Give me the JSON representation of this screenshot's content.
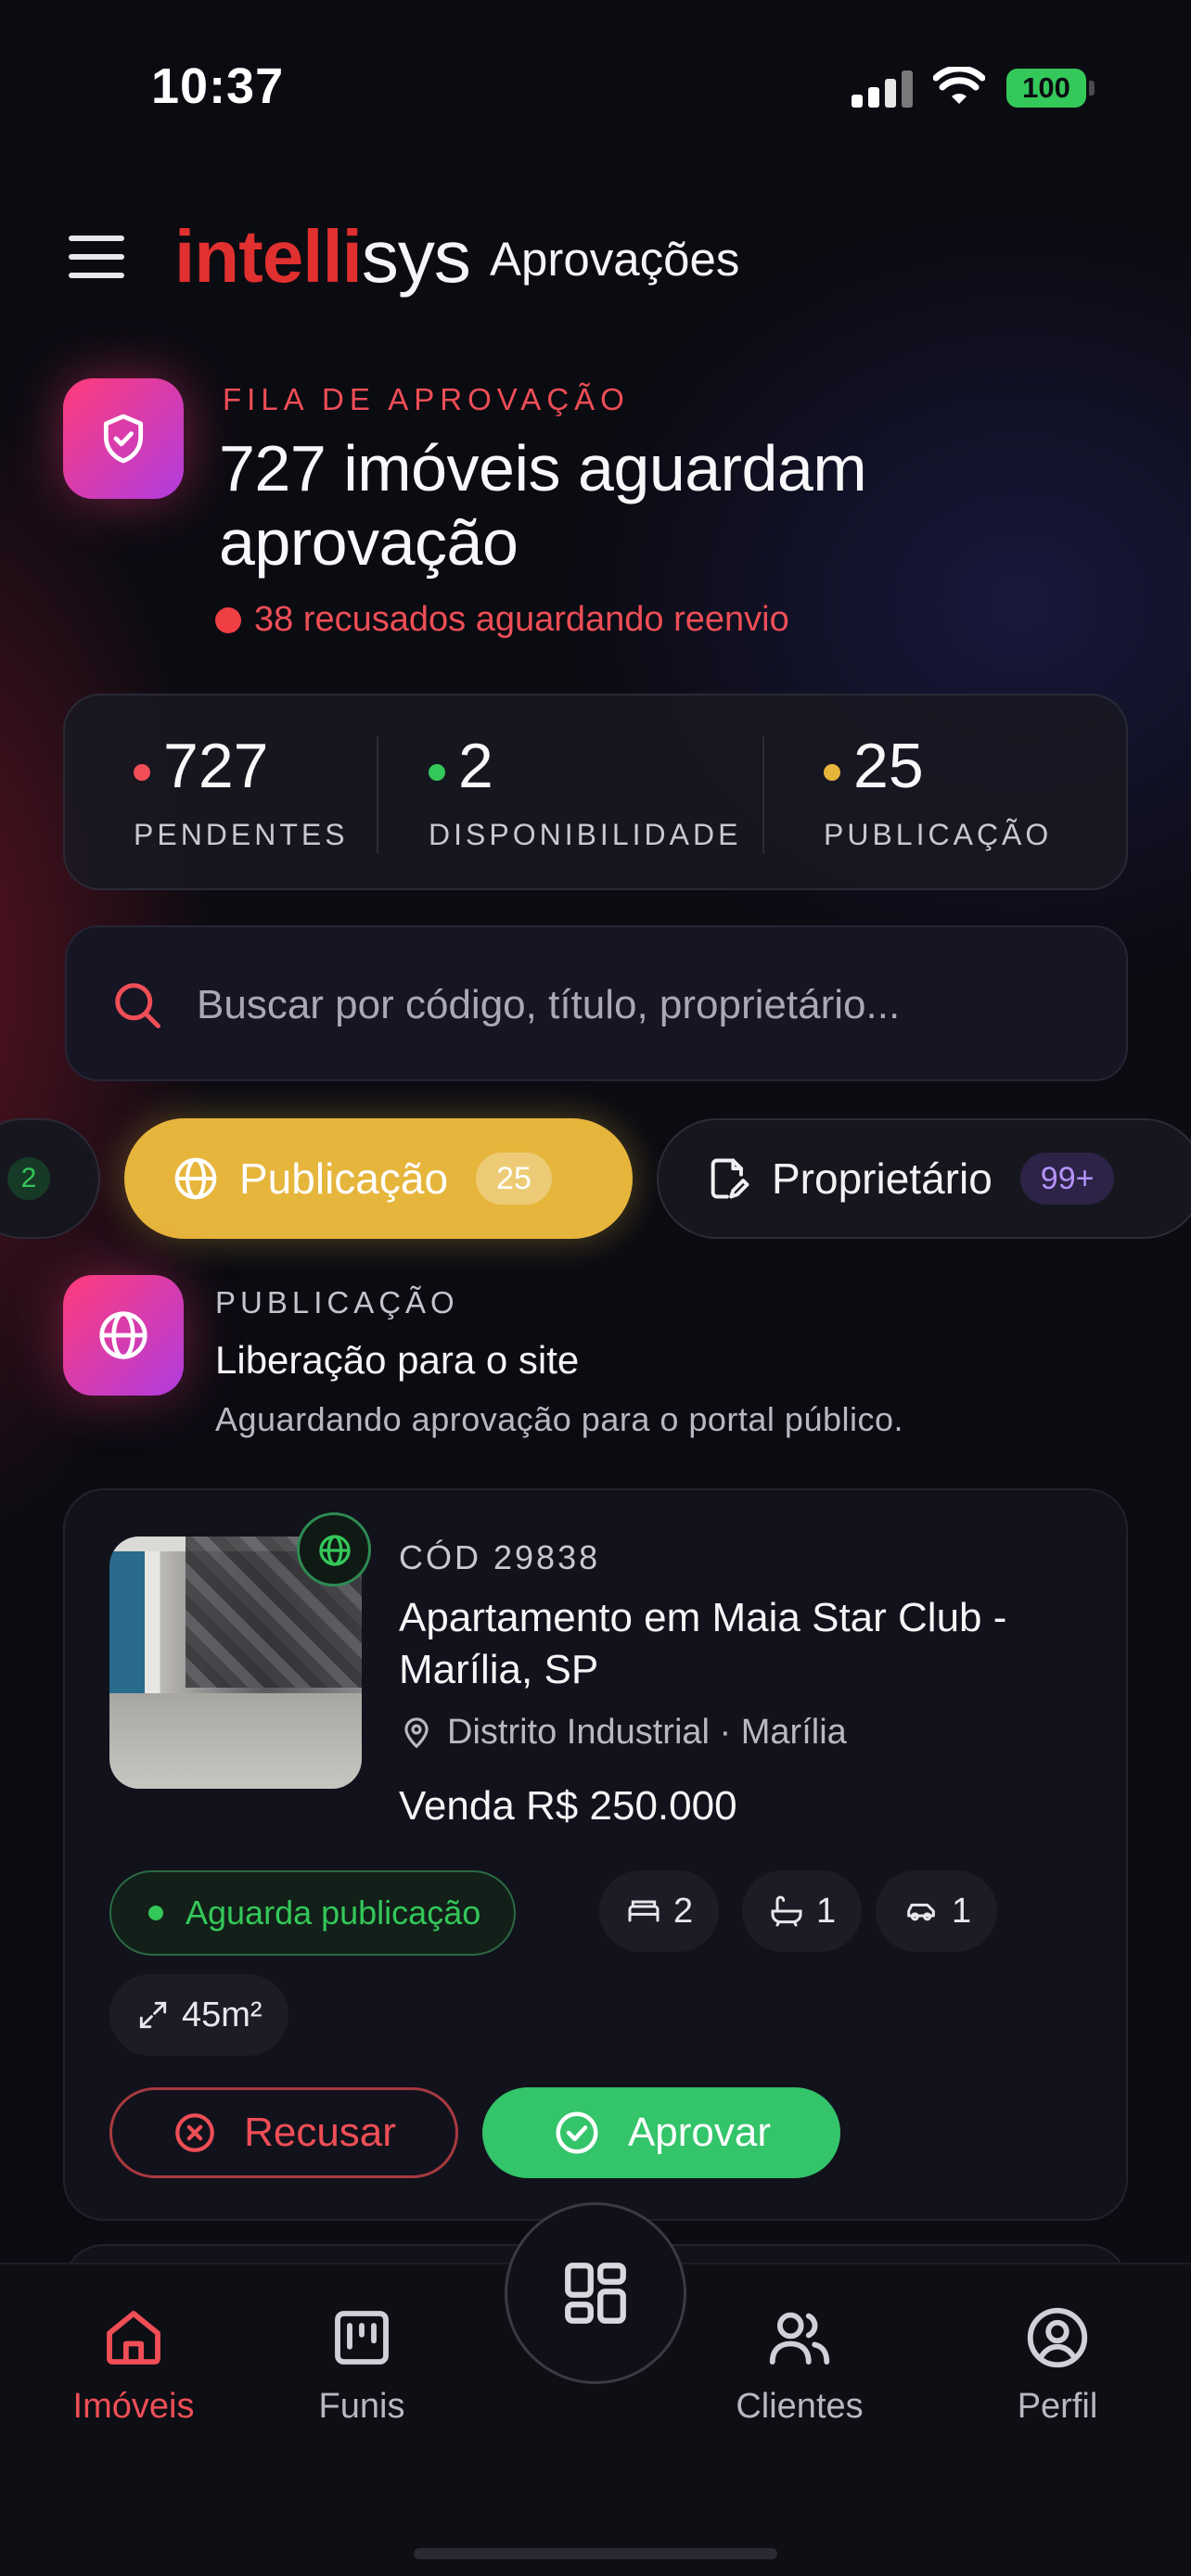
{
  "status_bar": {
    "time": "10:37",
    "battery": "100"
  },
  "header": {
    "logo_red": "intelli",
    "logo_white": "sys",
    "title": "Aprovações"
  },
  "hero": {
    "eyebrow": "FILA DE APROVAÇÃO",
    "title": "727 imóveis aguardam aprovação",
    "subtitle": "38 recusados aguardando reenvio"
  },
  "stats": [
    {
      "value": "727",
      "label": "PENDENTES",
      "color": "#ef4e56"
    },
    {
      "value": "2",
      "label": "DISPONIBILIDADE",
      "color": "#34c759"
    },
    {
      "value": "25",
      "label": "PUBLICAÇÃO",
      "color": "#e6b53c"
    }
  ],
  "search": {
    "placeholder": "Buscar por código, título, proprietário..."
  },
  "filters": {
    "prev_count": "2",
    "active": {
      "label": "Publicação",
      "count": "25",
      "icon": "globe-icon"
    },
    "other": {
      "label": "Proprietário",
      "count": "99+",
      "icon": "edit-document-icon"
    }
  },
  "section": {
    "eyebrow": "PUBLICAÇÃO",
    "title": "Liberação para o site",
    "subtitle": "Aguardando aprovação para o portal público."
  },
  "property": {
    "code": "CÓD 29838",
    "title": "Apartamento em Maia Star Club - Marília, SP",
    "location": "Distrito Industrial · Marília",
    "price": "Venda R$ 250.000",
    "status": "Aguarda publicação",
    "bedrooms": "2",
    "bathrooms": "1",
    "parking": "1",
    "area": "45m²",
    "refuse_label": "Recusar",
    "approve_label": "Aprovar"
  },
  "nav": {
    "items": [
      {
        "label": "Imóveis",
        "icon": "home-icon",
        "active": true
      },
      {
        "label": "Funis",
        "icon": "kanban-icon"
      },
      {
        "label": "Clientes",
        "icon": "users-icon"
      },
      {
        "label": "Perfil",
        "icon": "profile-icon"
      }
    ],
    "fab_icon": "grid-icon"
  },
  "colors": {
    "accent_red": "#ef4e56",
    "accent_green": "#34c759",
    "accent_yellow": "#e6b53c",
    "accent_purple": "#b03ce0"
  }
}
